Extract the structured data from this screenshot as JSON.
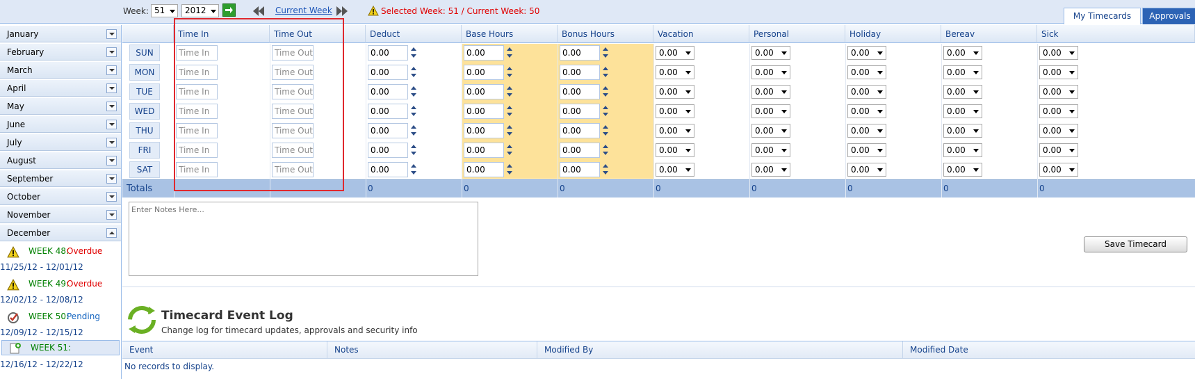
{
  "toolbar": {
    "week_label": "Week:",
    "week_value": "51",
    "year_value": "2012",
    "current_week_link": "Current Week",
    "status_message": "Selected Week: 51 / Current Week: 50"
  },
  "tabs": [
    {
      "label": "My Timecards",
      "active": true
    },
    {
      "label": "Approvals",
      "active": false
    }
  ],
  "sidebar": {
    "months": [
      "January",
      "February",
      "March",
      "April",
      "May",
      "June",
      "July",
      "August",
      "September",
      "October",
      "November",
      "December"
    ],
    "weeks": [
      {
        "label": "WEEK 48:",
        "status": "Overdue",
        "dates": "11/25/12 - 12/01/12",
        "icon": "warning-icon"
      },
      {
        "label": "WEEK 49:",
        "status": "Overdue",
        "dates": "12/02/12 - 12/08/12",
        "icon": "warning-icon"
      },
      {
        "label": "WEEK 50:",
        "status": "Pending",
        "dates": "12/09/12 - 12/15/12",
        "icon": "pending-check-icon"
      },
      {
        "label": "WEEK 51:",
        "status": "",
        "dates": "12/16/12 - 12/22/12",
        "icon": "new-document-icon"
      }
    ]
  },
  "grid": {
    "columns": [
      "Time In",
      "Time Out",
      "Deduct",
      "Base Hours",
      "Bonus Hours",
      "Vacation",
      "Personal",
      "Holiday",
      "Bereav",
      "Sick"
    ],
    "days": [
      "SUN",
      "MON",
      "TUE",
      "WED",
      "THU",
      "FRI",
      "SAT"
    ],
    "time_in_placeholder": "Time In",
    "time_out_placeholder": "Time Out",
    "cell_value": "0.00",
    "totals_label": "Totals",
    "totals": [
      "0",
      "0",
      "0",
      "0",
      "0",
      "0",
      "0",
      "0"
    ]
  },
  "notes_placeholder": "Enter Notes Here...",
  "save_label": "Save Timecard",
  "event_log": {
    "title": "Timecard Event Log",
    "subtitle": "Change log for timecard updates, approvals and security info",
    "columns": [
      "Event",
      "Notes",
      "Modified By",
      "Modified Date"
    ],
    "empty_text": "No records to display."
  },
  "colors": {
    "accent": "#15428b",
    "header_bg": "#dfe8f6",
    "highlight": "#fde29a",
    "overdue": "#e00000",
    "pending": "#1565c0",
    "week_label": "#008000",
    "annotation_box": "#e0282e"
  }
}
